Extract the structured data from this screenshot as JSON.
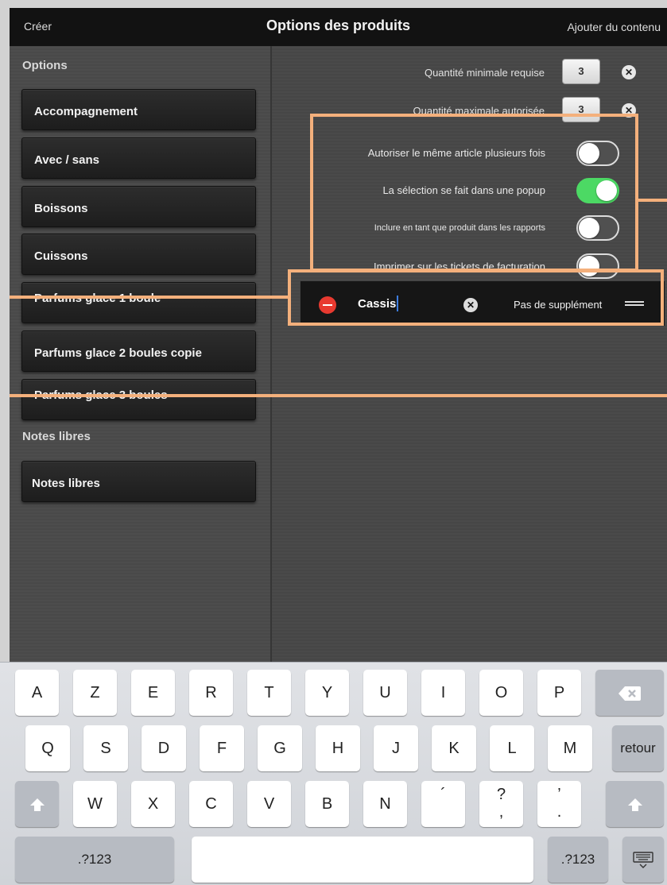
{
  "topbar": {
    "left_label": "Créer",
    "title": "Options des produits",
    "right_label": "Ajouter du contenu"
  },
  "sidebar": {
    "options_header": "Options",
    "options": [
      "Accompagnement",
      "Avec / sans",
      "Boissons",
      "Cuissons",
      "Parfums glace 1 boule",
      "Parfums glace 2 boules copie",
      "Parfums glace 3 boules"
    ],
    "notes_header": "Notes libres",
    "notes": [
      "Notes libres"
    ]
  },
  "quantities": {
    "min_label": "Quantité minimale requise",
    "min_value": "3",
    "max_label": "Quantité maximale autorisée",
    "max_value": "3"
  },
  "toggles": [
    {
      "label": "Autoriser le même article plusieurs fois",
      "on": false
    },
    {
      "label": "La sélection se fait dans une popup",
      "on": true
    },
    {
      "label": "Inclure en tant que produit dans les rapports",
      "on": false
    },
    {
      "label": "Imprimer sur les tickets de facturation",
      "on": false
    }
  ],
  "item": {
    "name": "Cassis",
    "supplement": "Pas de supplément"
  },
  "keyboard": {
    "row1": [
      "A",
      "Z",
      "E",
      "R",
      "T",
      "Y",
      "U",
      "I",
      "O",
      "P"
    ],
    "row2": [
      "Q",
      "S",
      "D",
      "F",
      "G",
      "H",
      "J",
      "K",
      "L",
      "M"
    ],
    "return_label": "retour",
    "row3": [
      "W",
      "X",
      "C",
      "V",
      "B",
      "N"
    ],
    "row3_punct": [
      "´",
      "?\n,",
      "’\n."
    ],
    "numbers_label": ".?123"
  },
  "colors": {
    "toggle_on": "#4cd964",
    "annotation": "#f4b07c",
    "delete_red": "#e83a30"
  }
}
